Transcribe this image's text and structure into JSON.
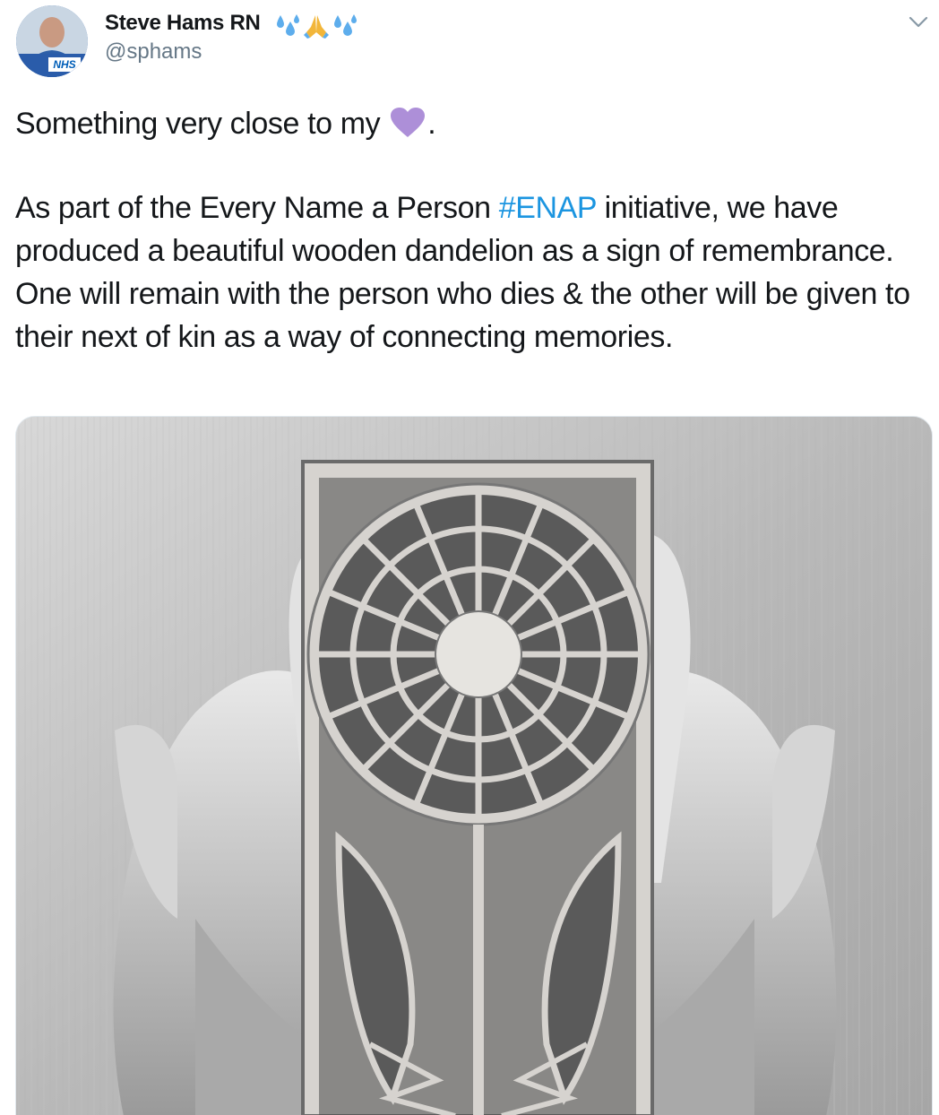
{
  "author": {
    "display_name": "Steve Hams RN",
    "handle": "@sphams",
    "avatar_badge": "NHS",
    "name_emojis": [
      "sweat-droplets-icon",
      "folded-hands-icon",
      "sweat-droplets-icon"
    ]
  },
  "tweet": {
    "line1_before": "Something very close to my",
    "line1_after": ".",
    "para_before": "As part of the Every Name a Person ",
    "hashtag": "#ENAP",
    "para_after": " initiative, we have produced a beautiful wooden dandelion as a sign of remembrance. One will remain with the person who dies & the other will be given to their next of kin as a way of connecting memories."
  },
  "media": {
    "description_icon": "wooden-dandelion-photo"
  },
  "colors": {
    "link": "#1b95e0",
    "handle": "#657786",
    "heart": "#ad8fd8",
    "text": "#14171a"
  }
}
